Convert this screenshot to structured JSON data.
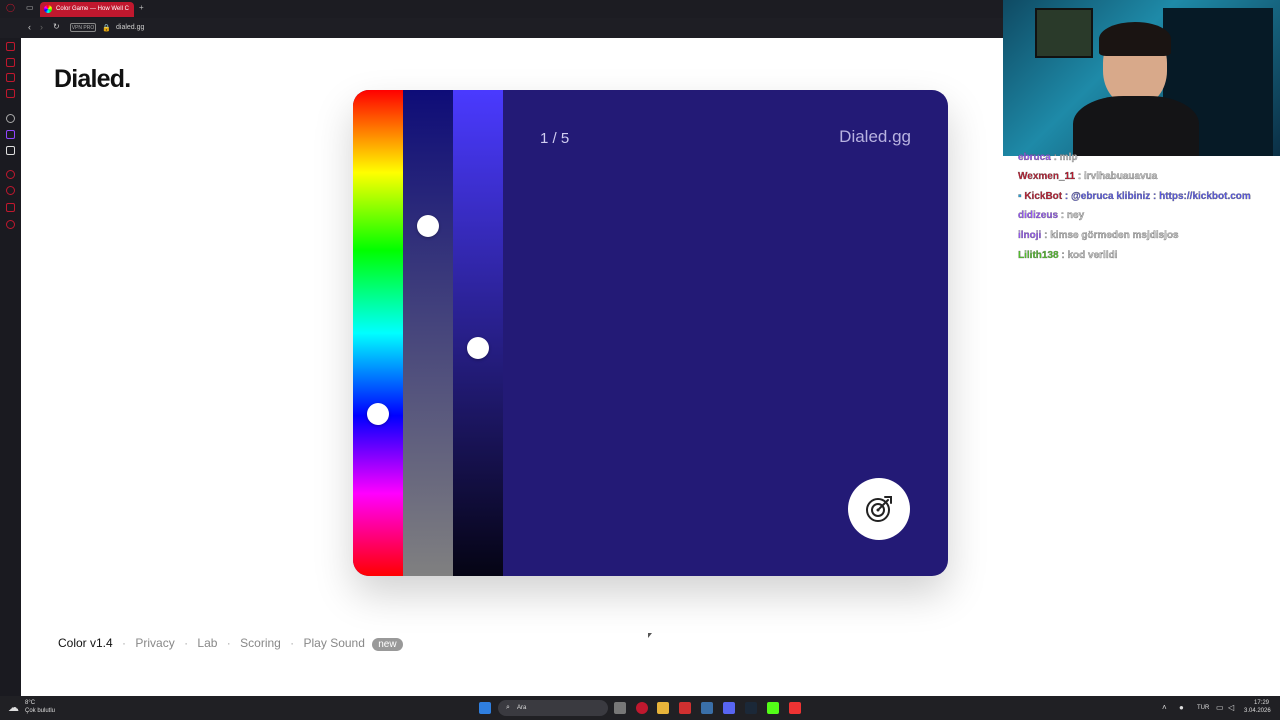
{
  "browser": {
    "tab_title": "Color Game — How Well C",
    "new_tab": "+",
    "vpn": "VPN PRO",
    "url": "dialed.gg"
  },
  "page": {
    "logo": "Dialed.",
    "counter": "1 / 5",
    "brand": "Dialed.gg",
    "color_hex": "#231a76",
    "hue_level": 0.66,
    "saturation_level": 0.28,
    "lightness_level": 0.53
  },
  "footer": {
    "version": "Color v1.4",
    "privacy": "Privacy",
    "lab": "Lab",
    "scoring": "Scoring",
    "play_sound": "Play Sound",
    "badge": "new",
    "sep": "·"
  },
  "chat": {
    "messages": [
      {
        "name": "ebruca",
        "text": ": mlp",
        "color": "#9b59ff"
      },
      {
        "name": "Wexmen_11",
        "text": ": irvihabuauavua",
        "color": "#c0182e"
      },
      {
        "name": "KickBot",
        "text": ": @ebruca klibiniz : https://kickbot.com",
        "color": "#c0182e"
      },
      {
        "name": "didizeus",
        "text": ": ney",
        "color": "#9b59ff"
      },
      {
        "name": "ilnoji",
        "text": ": kimse görmeden msjdisjos",
        "color": "#9b59ff"
      },
      {
        "name": "Lilith138",
        "text": ": kod verildi",
        "color": "#53c428"
      }
    ]
  },
  "taskbar": {
    "weather_temp": "8°C",
    "weather_desc": "Çok bulutlu",
    "search": "Ara",
    "lang": "TUR",
    "time": "17:29",
    "date": "3.04.2026"
  }
}
